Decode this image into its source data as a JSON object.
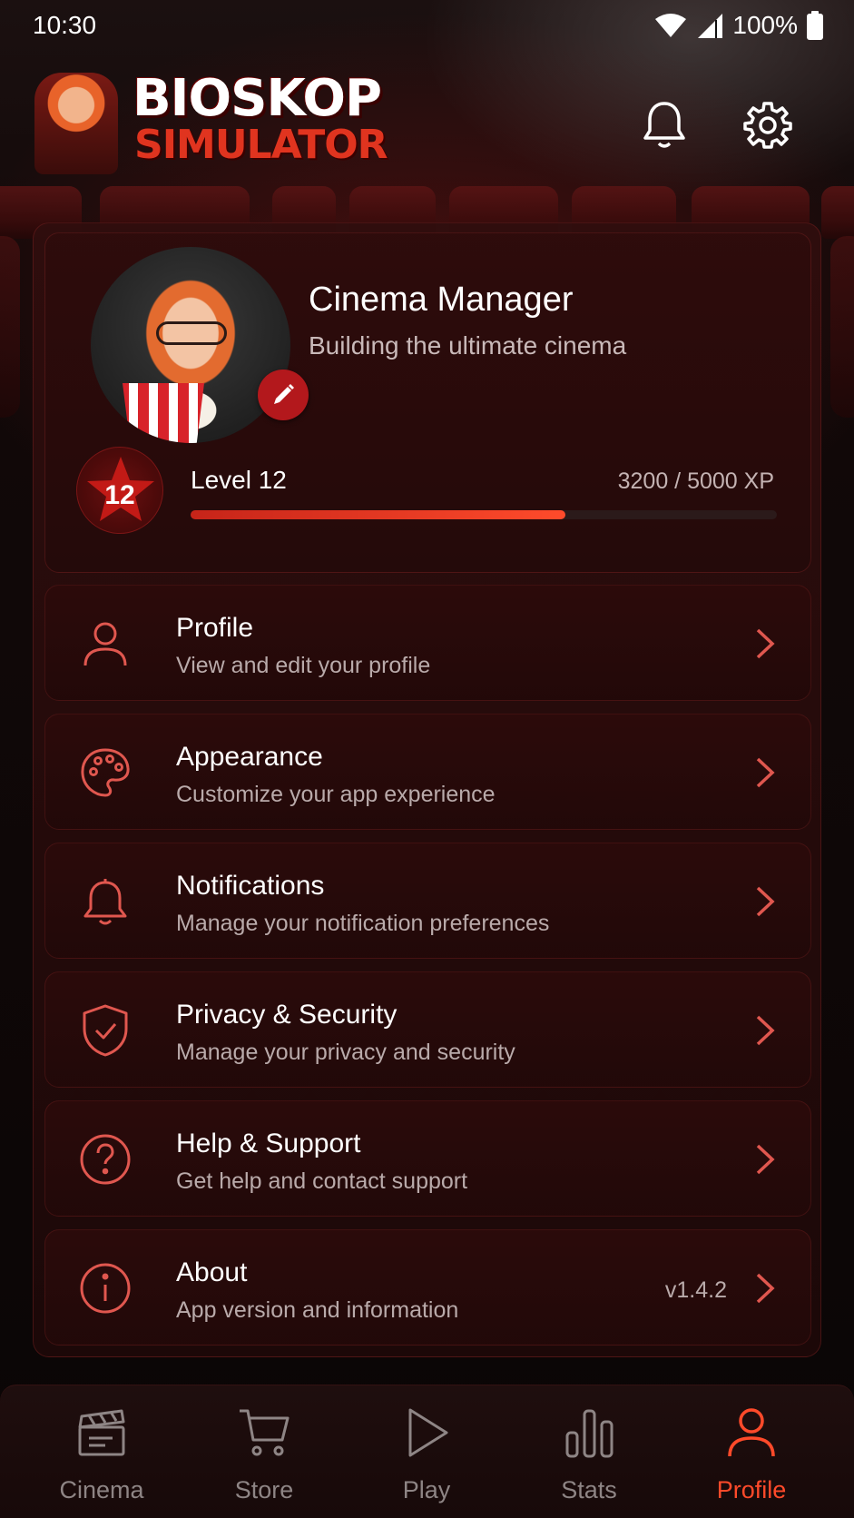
{
  "status_bar": {
    "time": "10:30",
    "battery_pct": "100%"
  },
  "header": {
    "logo_line1": "BIOSKOP",
    "logo_line2": "SIMULATOR"
  },
  "profile": {
    "name": "Cinema Manager",
    "tagline": "Building the ultimate cinema",
    "level_badge": "12",
    "level_label": "Level 12",
    "xp_text": "3200 / 5000 XP",
    "xp_progress": 0.64
  },
  "menu": [
    {
      "icon": "user-icon",
      "title": "Profile",
      "subtitle": "View and edit your profile"
    },
    {
      "icon": "palette-icon",
      "title": "Appearance",
      "subtitle": "Customize your app experience"
    },
    {
      "icon": "bell-icon",
      "title": "Notifications",
      "subtitle": "Manage your notification preferences"
    },
    {
      "icon": "shield-icon",
      "title": "Privacy & Security",
      "subtitle": "Manage your privacy and security"
    },
    {
      "icon": "help-icon",
      "title": "Help & Support",
      "subtitle": "Get help and contact support"
    },
    {
      "icon": "info-icon",
      "title": "About",
      "subtitle": "App version and information",
      "version": "v1.4.2"
    }
  ],
  "bottom_nav": [
    {
      "icon": "clapperboard-icon",
      "label": "Cinema"
    },
    {
      "icon": "cart-icon",
      "label": "Store"
    },
    {
      "icon": "play-icon",
      "label": "Play"
    },
    {
      "icon": "bar-chart-icon",
      "label": "Stats"
    },
    {
      "icon": "user-icon",
      "label": "Profile",
      "active": true
    }
  ],
  "colors": {
    "accent": "#ff4a2a",
    "icon_red": "#e0574f",
    "inactive": "#8e8585"
  }
}
